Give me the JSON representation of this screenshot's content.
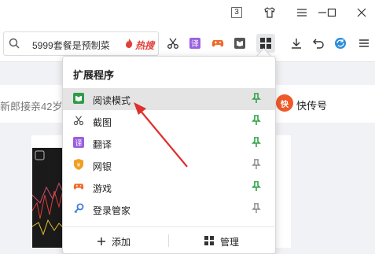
{
  "titlebar": {
    "tab_count": "3"
  },
  "search": {
    "query": "5999套餐是预制菜",
    "hot_label": "热搜"
  },
  "background": {
    "news_text": "新郎接亲42岁",
    "kuai_logo": "快",
    "kuai_label": "快传号"
  },
  "extensions_menu": {
    "title": "扩展程序",
    "items": [
      {
        "label": "阅读模式",
        "icon": "reading-mode-icon",
        "icon_color": "#2e9b47",
        "pinned": true,
        "selected": true
      },
      {
        "label": "截图",
        "icon": "scissors-icon",
        "icon_color": "#555555",
        "pinned": true,
        "selected": false
      },
      {
        "label": "翻译",
        "icon": "translate-icon",
        "icon_color": "#9a5fe0",
        "pinned": true,
        "selected": false
      },
      {
        "label": "网银",
        "icon": "bank-shield-icon",
        "icon_color": "#f0a020",
        "pinned": false,
        "selected": false
      },
      {
        "label": "游戏",
        "icon": "gamepad-icon",
        "icon_color": "#f06a2a",
        "pinned": true,
        "selected": false
      },
      {
        "label": "登录管家",
        "icon": "key-icon",
        "icon_color": "#3d7de0",
        "pinned": false,
        "selected": false
      }
    ],
    "add_label": "添加",
    "manage_label": "管理"
  },
  "colors": {
    "pin_on": "#2ea44a",
    "pin_off": "#888888",
    "arrow": "#e0302a"
  }
}
